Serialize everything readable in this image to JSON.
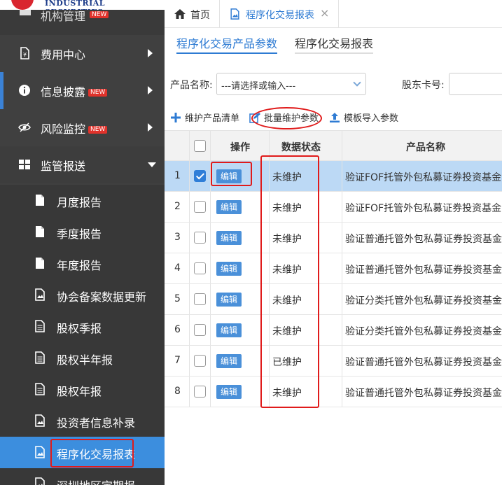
{
  "brand": {
    "logo_text": "INDUSTRIAL SECURITIES",
    "partial_menu_label": "机构管理",
    "partial_menu_badge": "NEW"
  },
  "sidebar": {
    "items": [
      {
        "label": "费用中心",
        "icon": "document-money-icon",
        "badge": ""
      },
      {
        "label": "信息披露",
        "icon": "info-icon",
        "badge": "NEW"
      },
      {
        "label": "风险监控",
        "icon": "eye-icon",
        "badge": "NEW"
      },
      {
        "label": "监管报送",
        "icon": "grid-icon",
        "badge": ""
      }
    ],
    "sub_items": [
      {
        "label": "月度报告",
        "icon": "file-icon"
      },
      {
        "label": "季度报告",
        "icon": "file-icon"
      },
      {
        "label": "年度报告",
        "icon": "file-icon"
      },
      {
        "label": "协会备案数据更新",
        "icon": "image-file-icon"
      },
      {
        "label": "股权季报",
        "icon": "text-file-icon"
      },
      {
        "label": "股权半年报",
        "icon": "text-file-icon"
      },
      {
        "label": "股权年报",
        "icon": "text-file-icon"
      },
      {
        "label": "投资者信息补录",
        "icon": "image-file-icon"
      },
      {
        "label": "程序化交易报表",
        "icon": "image-file-icon"
      },
      {
        "label": "深圳地区定期报",
        "icon": "image-file-icon"
      }
    ]
  },
  "tabs": [
    {
      "label": "首页",
      "icon": "home-icon"
    },
    {
      "label": "程序化交易报表",
      "icon": "image-file-icon",
      "close": "×"
    }
  ],
  "sub_tabs": [
    "程序化交易产品参数",
    "程序化交易报表"
  ],
  "form": {
    "product_name_label": "产品名称:",
    "product_name_value": "---请选择或输入---",
    "shareholder_label": "股东卡号:"
  },
  "toolbar": [
    {
      "label": "维护产品清单",
      "icon": "plus-icon"
    },
    {
      "label": "批量维护参数",
      "icon": "edit-icon"
    },
    {
      "label": "模板导入参数",
      "icon": "upload-icon"
    }
  ],
  "table": {
    "headers": [
      "操作",
      "数据状态",
      "产品名称"
    ],
    "edit_label": "编辑",
    "rows": [
      {
        "num": "1",
        "checked": true,
        "status": "未维护",
        "name": "验证FOF托管外包私募证券投资基金"
      },
      {
        "num": "2",
        "checked": false,
        "status": "未维护",
        "name": "验证FOF托管外包私募证券投资基金"
      },
      {
        "num": "3",
        "checked": false,
        "status": "未维护",
        "name": "验证普通托管外包私募证券投资基金"
      },
      {
        "num": "4",
        "checked": false,
        "status": "未维护",
        "name": "验证普通托管外包私募证券投资基金"
      },
      {
        "num": "5",
        "checked": false,
        "status": "未维护",
        "name": "验证分类托管外包私募证券投资基金"
      },
      {
        "num": "6",
        "checked": false,
        "status": "未维护",
        "name": "验证分类托管外包私募证券投资基金"
      },
      {
        "num": "7",
        "checked": false,
        "status": "已维护",
        "name": "验证普通托管外包私募证券投资基金"
      },
      {
        "num": "8",
        "checked": false,
        "status": "未维护",
        "name": "验证普通托管外包私募证券投资基金"
      }
    ]
  },
  "colors": {
    "accent": "#2e7bd3",
    "sidebar_bg": "#404040",
    "annotation": "#e01b1b",
    "badge": "#e0322b"
  }
}
